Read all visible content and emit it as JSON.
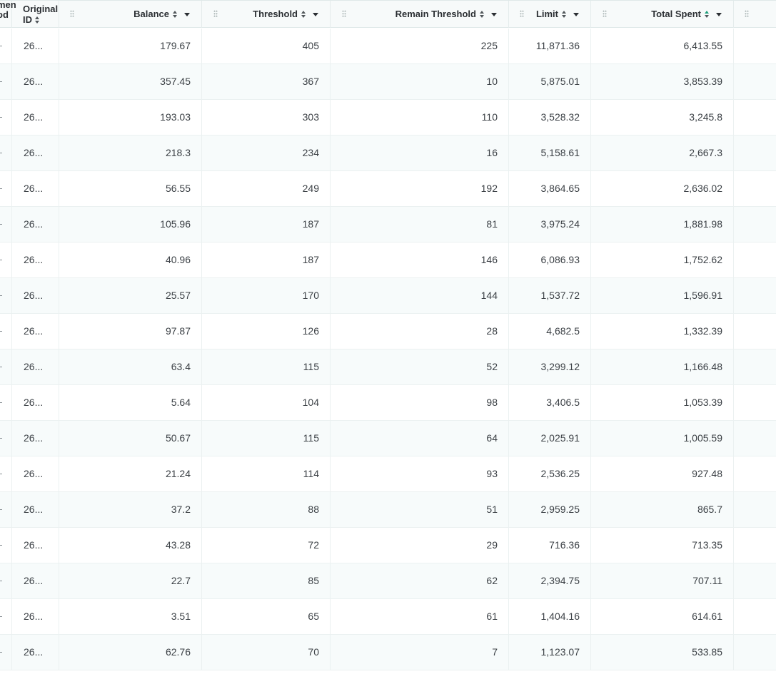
{
  "header": {
    "cut_col_lines": [
      "men",
      "od"
    ],
    "original_id_lines": [
      "Original",
      "ID"
    ],
    "balance": "Balance",
    "threshold": "Threshold",
    "remain_threshold": "Remain Threshold",
    "limit": "Limit",
    "total_spent": "Total Spent"
  },
  "sort": {
    "active_column": "total_spent"
  },
  "rows": [
    {
      "id": "26...",
      "balance": "179.67",
      "threshold": "405",
      "remain": "225",
      "limit": "11,871.36",
      "spent": "6,413.55"
    },
    {
      "id": "26...",
      "balance": "357.45",
      "threshold": "367",
      "remain": "10",
      "limit": "5,875.01",
      "spent": "3,853.39"
    },
    {
      "id": "26...",
      "balance": "193.03",
      "threshold": "303",
      "remain": "110",
      "limit": "3,528.32",
      "spent": "3,245.8"
    },
    {
      "id": "26...",
      "balance": "218.3",
      "threshold": "234",
      "remain": "16",
      "limit": "5,158.61",
      "spent": "2,667.3"
    },
    {
      "id": "26...",
      "balance": "56.55",
      "threshold": "249",
      "remain": "192",
      "limit": "3,864.65",
      "spent": "2,636.02"
    },
    {
      "id": "26...",
      "balance": "105.96",
      "threshold": "187",
      "remain": "81",
      "limit": "3,975.24",
      "spent": "1,881.98"
    },
    {
      "id": "26...",
      "balance": "40.96",
      "threshold": "187",
      "remain": "146",
      "limit": "6,086.93",
      "spent": "1,752.62"
    },
    {
      "id": "26...",
      "balance": "25.57",
      "threshold": "170",
      "remain": "144",
      "limit": "1,537.72",
      "spent": "1,596.91"
    },
    {
      "id": "26...",
      "balance": "97.87",
      "threshold": "126",
      "remain": "28",
      "limit": "4,682.5",
      "spent": "1,332.39"
    },
    {
      "id": "26...",
      "balance": "63.4",
      "threshold": "115",
      "remain": "52",
      "limit": "3,299.12",
      "spent": "1,166.48"
    },
    {
      "id": "26...",
      "balance": "5.64",
      "threshold": "104",
      "remain": "98",
      "limit": "3,406.5",
      "spent": "1,053.39"
    },
    {
      "id": "26...",
      "balance": "50.67",
      "threshold": "115",
      "remain": "64",
      "limit": "2,025.91",
      "spent": "1,005.59"
    },
    {
      "id": "26...",
      "balance": "21.24",
      "threshold": "114",
      "remain": "93",
      "limit": "2,536.25",
      "spent": "927.48"
    },
    {
      "id": "26...",
      "balance": "37.2",
      "threshold": "88",
      "remain": "51",
      "limit": "2,959.25",
      "spent": "865.7"
    },
    {
      "id": "26...",
      "balance": "43.28",
      "threshold": "72",
      "remain": "29",
      "limit": "716.36",
      "spent": "713.35"
    },
    {
      "id": "26...",
      "balance": "22.7",
      "threshold": "85",
      "remain": "62",
      "limit": "2,394.75",
      "spent": "707.11"
    },
    {
      "id": "26...",
      "balance": "3.51",
      "threshold": "65",
      "remain": "61",
      "limit": "1,404.16",
      "spent": "614.61"
    },
    {
      "id": "26...",
      "balance": "62.76",
      "threshold": "70",
      "remain": "7",
      "limit": "1,123.07",
      "spent": "533.85"
    }
  ]
}
